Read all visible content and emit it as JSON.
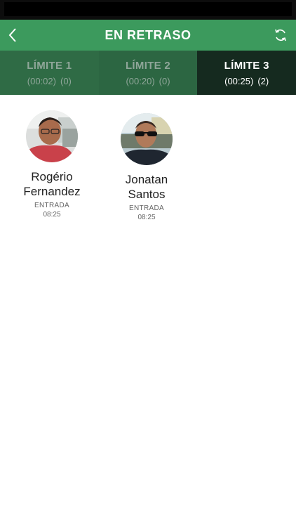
{
  "nav": {
    "title": "EN RETRASO"
  },
  "tabs": [
    {
      "label": "LÍMITE 1",
      "time": "(00:02)",
      "count": "(0)",
      "active": false
    },
    {
      "label": "LÍMITE 2",
      "time": "(00:20)",
      "count": "(0)",
      "active": false
    },
    {
      "label": "LÍMITE 3",
      "time": "(00:25)",
      "count": "(2)",
      "active": true
    }
  ],
  "people": [
    {
      "first_name": "Rogério",
      "last_name": "Fernandez",
      "entry_label": "ENTRADA",
      "entry_time": "08:25"
    },
    {
      "first_name": "Jonatan",
      "last_name": "Santos",
      "entry_label": "ENTRADA",
      "entry_time": "08:25"
    }
  ],
  "colors": {
    "nav": "#3c9a5d",
    "tab_inactive": "#2f6b45",
    "tab_active": "#152a1f"
  },
  "icons": {
    "back": "chevron-left-icon",
    "refresh": "refresh-icon"
  }
}
